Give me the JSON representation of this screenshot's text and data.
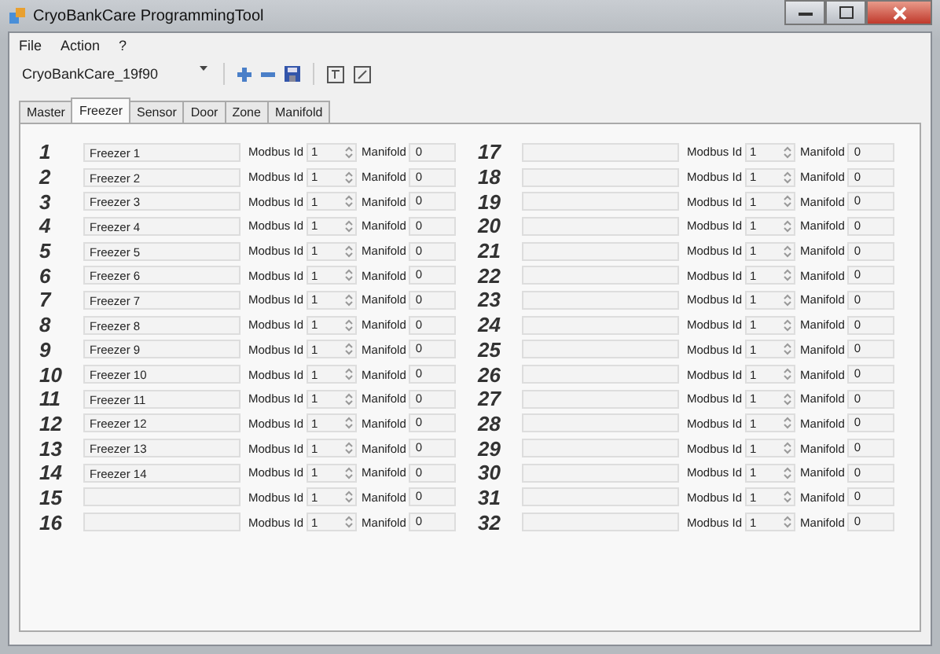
{
  "window": {
    "title": "CryoBankCare ProgrammingTool"
  },
  "menu": [
    "File",
    "Action",
    "?"
  ],
  "toolbar": {
    "selector": "CryoBankCare_19f90"
  },
  "tabs": [
    {
      "label": "Master",
      "selected": false
    },
    {
      "label": "Freezer",
      "selected": true
    },
    {
      "label": "Sensor",
      "selected": false
    },
    {
      "label": "Door",
      "selected": false
    },
    {
      "label": "Zone",
      "selected": false
    },
    {
      "label": "Manifold",
      "selected": false
    }
  ],
  "freezers": [
    {
      "number": "1",
      "name": "Freezer 1",
      "modbus_label": "Modbus Id",
      "modbus_id": "1",
      "manifold_label": "Manifold",
      "manifold": "0"
    },
    {
      "number": "2",
      "name": "Freezer 2",
      "modbus_label": "Modbus Id",
      "modbus_id": "1",
      "manifold_label": "Manifold",
      "manifold": "0"
    },
    {
      "number": "3",
      "name": "Freezer 3",
      "modbus_label": "Modbus Id",
      "modbus_id": "1",
      "manifold_label": "Manifold",
      "manifold": "0"
    },
    {
      "number": "4",
      "name": "Freezer 4",
      "modbus_label": "Modbus Id",
      "modbus_id": "1",
      "manifold_label": "Manifold",
      "manifold": "0"
    },
    {
      "number": "5",
      "name": "Freezer 5",
      "modbus_label": "Modbus Id",
      "modbus_id": "1",
      "manifold_label": "Manifold",
      "manifold": "0"
    },
    {
      "number": "6",
      "name": "Freezer 6",
      "modbus_label": "Modbus Id",
      "modbus_id": "1",
      "manifold_label": "Manifold",
      "manifold": "0"
    },
    {
      "number": "7",
      "name": "Freezer 7",
      "modbus_label": "Modbus Id",
      "modbus_id": "1",
      "manifold_label": "Manifold",
      "manifold": "0"
    },
    {
      "number": "8",
      "name": "Freezer 8",
      "modbus_label": "Modbus Id",
      "modbus_id": "1",
      "manifold_label": "Manifold",
      "manifold": "0"
    },
    {
      "number": "9",
      "name": "Freezer 9",
      "modbus_label": "Modbus Id",
      "modbus_id": "1",
      "manifold_label": "Manifold",
      "manifold": "0"
    },
    {
      "number": "10",
      "name": "Freezer 10",
      "modbus_label": "Modbus Id",
      "modbus_id": "1",
      "manifold_label": "Manifold",
      "manifold": "0"
    },
    {
      "number": "11",
      "name": "Freezer 11",
      "modbus_label": "Modbus Id",
      "modbus_id": "1",
      "manifold_label": "Manifold",
      "manifold": "0"
    },
    {
      "number": "12",
      "name": "Freezer 12",
      "modbus_label": "Modbus Id",
      "modbus_id": "1",
      "manifold_label": "Manifold",
      "manifold": "0"
    },
    {
      "number": "13",
      "name": "Freezer 13",
      "modbus_label": "Modbus Id",
      "modbus_id": "1",
      "manifold_label": "Manifold",
      "manifold": "0"
    },
    {
      "number": "14",
      "name": "Freezer 14",
      "modbus_label": "Modbus Id",
      "modbus_id": "1",
      "manifold_label": "Manifold",
      "manifold": "0"
    },
    {
      "number": "15",
      "modbus_label": "Modbus Id",
      "modbus_id": "1",
      "manifold_label": "Manifold",
      "manifold": "0"
    },
    {
      "number": "16",
      "modbus_label": "Modbus Id",
      "modbus_id": "1",
      "manifold_label": "Manifold",
      "manifold": "0"
    },
    {
      "number": "17",
      "modbus_label": "Modbus Id",
      "modbus_id": "1",
      "manifold_label": "Manifold",
      "manifold": "0"
    },
    {
      "number": "18",
      "modbus_label": "Modbus Id",
      "modbus_id": "1",
      "manifold_label": "Manifold",
      "manifold": "0"
    },
    {
      "number": "19",
      "modbus_label": "Modbus Id",
      "modbus_id": "1",
      "manifold_label": "Manifold",
      "manifold": "0"
    },
    {
      "number": "20",
      "modbus_label": "Modbus Id",
      "modbus_id": "1",
      "manifold_label": "Manifold",
      "manifold": "0"
    },
    {
      "number": "21",
      "modbus_label": "Modbus Id",
      "modbus_id": "1",
      "manifold_label": "Manifold",
      "manifold": "0"
    },
    {
      "number": "22",
      "modbus_label": "Modbus Id",
      "modbus_id": "1",
      "manifold_label": "Manifold",
      "manifold": "0"
    },
    {
      "number": "23",
      "modbus_label": "Modbus Id",
      "modbus_id": "1",
      "manifold_label": "Manifold",
      "manifold": "0"
    },
    {
      "number": "24",
      "modbus_label": "Modbus Id",
      "modbus_id": "1",
      "manifold_label": "Manifold",
      "manifold": "0"
    },
    {
      "number": "25",
      "modbus_label": "Modbus Id",
      "modbus_id": "1",
      "manifold_label": "Manifold",
      "manifold": "0"
    },
    {
      "number": "26",
      "modbus_label": "Modbus Id",
      "modbus_id": "1",
      "manifold_label": "Manifold",
      "manifold": "0"
    },
    {
      "number": "27",
      "modbus_label": "Modbus Id",
      "modbus_id": "1",
      "manifold_label": "Manifold",
      "manifold": "0"
    },
    {
      "number": "28",
      "modbus_label": "Modbus Id",
      "modbus_id": "1",
      "manifold_label": "Manifold",
      "manifold": "0"
    },
    {
      "number": "29",
      "modbus_label": "Modbus Id",
      "modbus_id": "1",
      "manifold_label": "Manifold",
      "manifold": "0"
    },
    {
      "number": "30",
      "modbus_label": "Modbus Id",
      "modbus_id": "1",
      "manifold_label": "Manifold",
      "manifold": "0"
    },
    {
      "number": "31",
      "modbus_label": "Modbus Id",
      "modbus_id": "1",
      "manifold_label": "Manifold",
      "manifold": "0"
    },
    {
      "number": "32",
      "modbus_label": "Modbus Id",
      "modbus_id": "1",
      "manifold_label": "Manifold",
      "manifold": "0"
    }
  ]
}
